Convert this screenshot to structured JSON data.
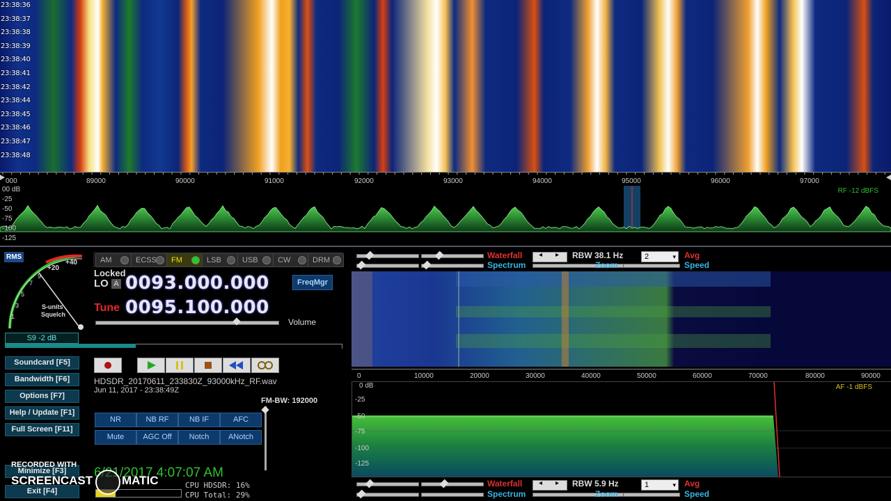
{
  "main_waterfall": {
    "timestamps": [
      "23:38:36",
      "23:38:37",
      "23:38:38",
      "23:38:39",
      "23:38:40",
      "23:38:41",
      "23:38:42",
      "23:38:44",
      "23:38:45",
      "23:38:46",
      "23:38:47",
      "23:38:48"
    ],
    "freq_ticks": [
      "000",
      "89000",
      "90000",
      "91000",
      "92000",
      "93000",
      "94000",
      "95000",
      "96000",
      "97000"
    ]
  },
  "main_spectrum": {
    "db_labels": [
      "00 dB",
      "-25",
      "-50",
      "-75",
      "-100",
      "-125"
    ],
    "rf_label": "RF -12 dBFS"
  },
  "smeter": {
    "rms_label": "RMS",
    "scale_labels": [
      "+40",
      "+20",
      "9",
      "7",
      "5",
      "3",
      "1"
    ],
    "sunits_label": "S-units",
    "squelch_label": "Squelch",
    "reading": "S9 -2 dB"
  },
  "modes": [
    {
      "label": "AM",
      "active": false
    },
    {
      "label": "ECSS",
      "active": false
    },
    {
      "label": "FM",
      "active": true
    },
    {
      "label": "LSB",
      "active": false
    },
    {
      "label": "USB",
      "active": false
    },
    {
      "label": "CW",
      "active": false
    },
    {
      "label": "DRM",
      "active": false
    }
  ],
  "lo": {
    "locked_label": "Locked",
    "lo_label": "LO",
    "lo_badge": "A",
    "frequency": "0093.000.000"
  },
  "tune": {
    "label": "Tune",
    "frequency": "0095.100.000"
  },
  "freqmgr_label": "FreqMgr",
  "volume_label": "Volume",
  "side_buttons": {
    "soundcard": "Soundcard [F5]",
    "bandwidth": "Bandwidth [F6]",
    "options": "Options [F7]",
    "help": "Help / Update [F1]",
    "fullscreen": "Full Screen [F11]",
    "minimize": "Minimize [F3]",
    "exit": "Exit [F4]"
  },
  "recording": {
    "filename": "HDSDR_20170611_233830Z_93000kHz_RF.wav",
    "timestamp": "Jun 11, 2017 - 23:38:49Z"
  },
  "fm_bw": "FM-BW: 192000",
  "dsp_buttons": {
    "nr": "NR",
    "nb_rf": "NB RF",
    "nb_if": "NB IF",
    "afc": "AFC",
    "mute": "Mute",
    "agc_off": "AGC Off",
    "notch": "Notch",
    "anotch": "ANotch"
  },
  "clock": "6/21/2017 4:07:07 AM",
  "cpu": {
    "hdsdr": "CPU HDSDR: 16%",
    "total": "CPU Total: 29%"
  },
  "watermark": {
    "top": "RECORDED WITH",
    "brand_left": "SCREENCAST",
    "brand_right": "MATIC"
  },
  "af_top": {
    "waterfall_label": "Waterfall",
    "spectrum_label": "Spectrum",
    "rbw_label": "RBW 38.1 Hz",
    "select_value": "2",
    "zoom_label": "Zoom",
    "avg_label": "Avg",
    "speed_label": "Speed"
  },
  "af_scale": [
    "0",
    "10000",
    "20000",
    "30000",
    "40000",
    "50000",
    "60000",
    "70000",
    "80000",
    "90000"
  ],
  "af_spectrum": {
    "db_labels": [
      "0 dB",
      "-25",
      "-50",
      "-75",
      "-100",
      "-125"
    ],
    "af_label": "AF -1 dBFS"
  },
  "af_bottom": {
    "waterfall_label": "Waterfall",
    "spectrum_label": "Spectrum",
    "rbw_label": "RBW 5.9 Hz",
    "select_value": "1",
    "zoom_label": "Zoom",
    "avg_label": "Avg",
    "speed_label": "Speed"
  },
  "colors": {
    "accent_green": "#2ec02e",
    "tune_red": "#e02828",
    "label_cyan": "#37b4e6",
    "button_teal": "#0c3a4e"
  }
}
